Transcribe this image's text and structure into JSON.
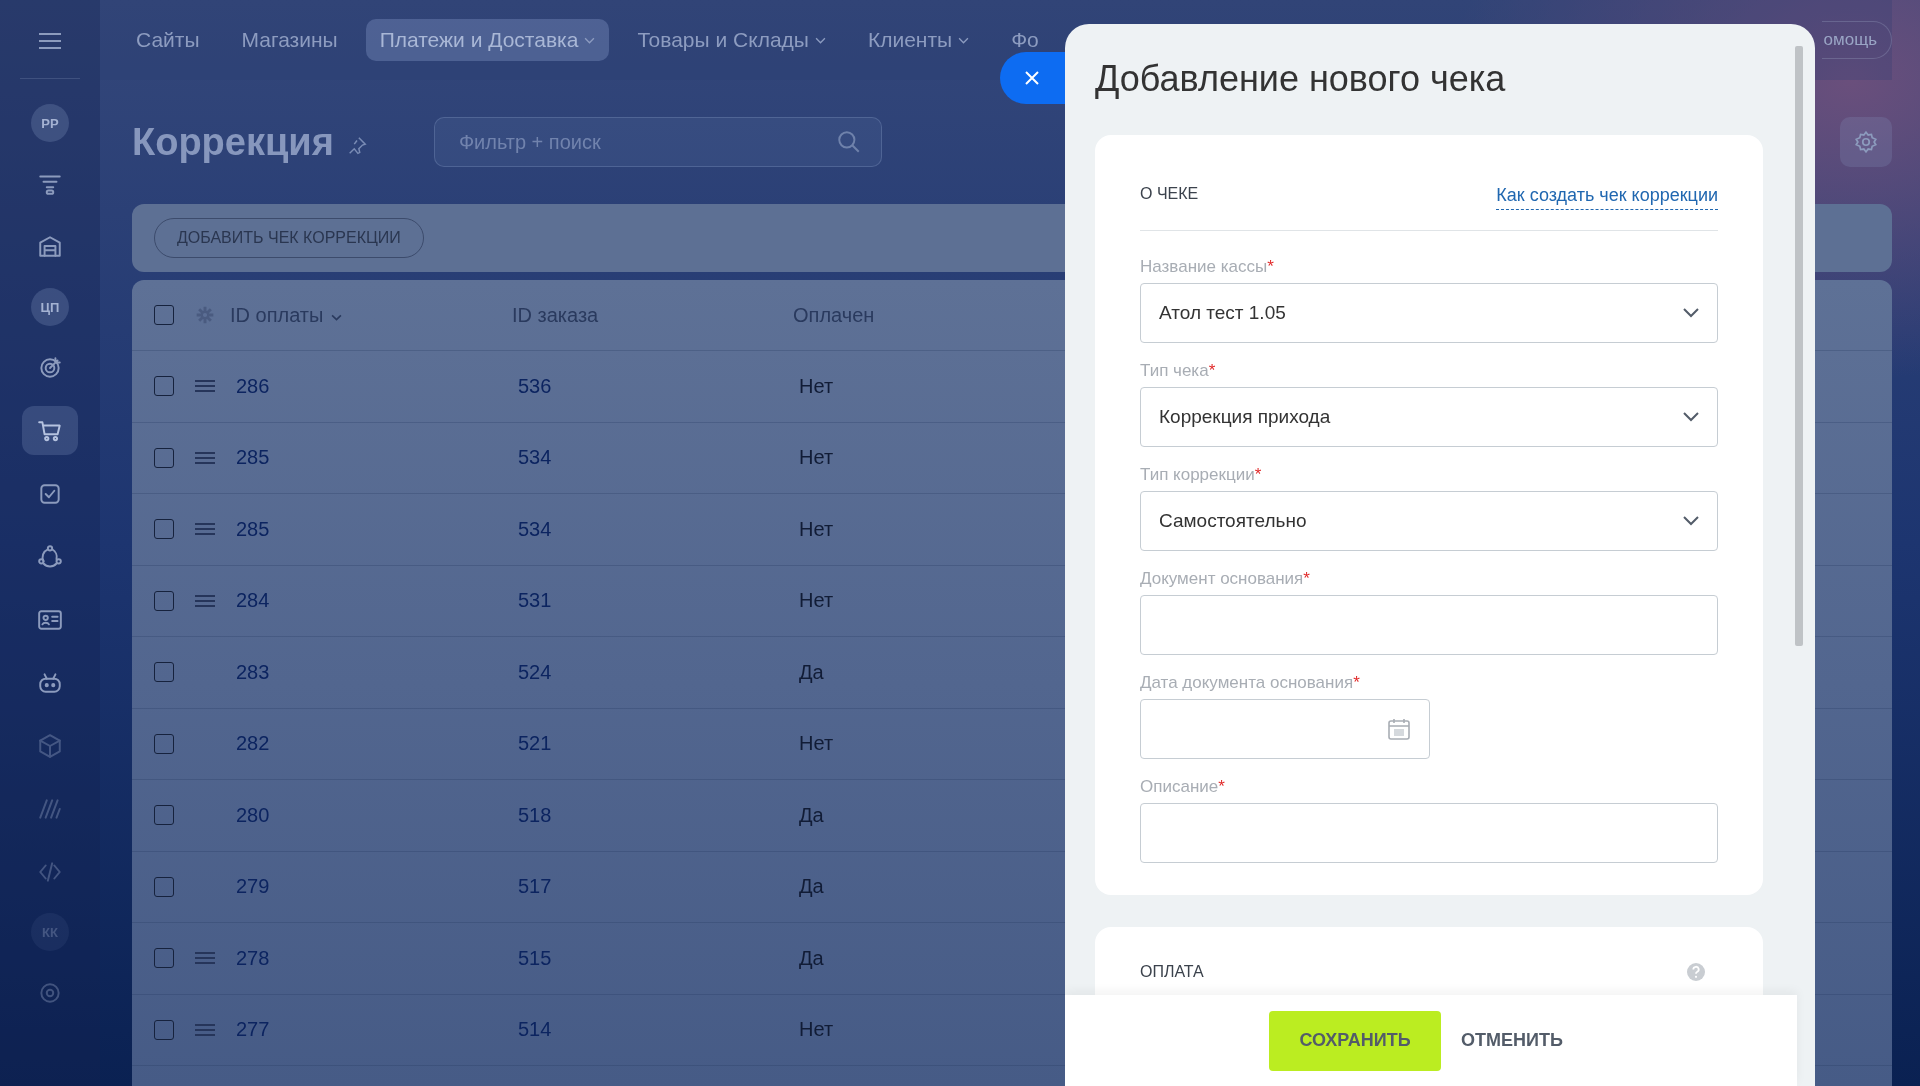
{
  "nav": {
    "items": [
      {
        "label": "Сайты",
        "selected": false,
        "dropdown": false
      },
      {
        "label": "Магазины",
        "selected": false,
        "dropdown": false
      },
      {
        "label": "Платежи и Доставка",
        "selected": true,
        "dropdown": true
      },
      {
        "label": "Товары и Склады",
        "selected": false,
        "dropdown": true
      },
      {
        "label": "Клиенты",
        "selected": false,
        "dropdown": true
      },
      {
        "label": "Фо",
        "selected": false,
        "dropdown": false
      }
    ],
    "help": "омощь"
  },
  "sidebar": {
    "items": [
      {
        "kind": "text",
        "label": "РР",
        "selected": false
      },
      {
        "kind": "icon",
        "selected": false
      },
      {
        "kind": "icon",
        "selected": false
      },
      {
        "kind": "text",
        "label": "ЦП",
        "selected": false
      },
      {
        "kind": "icon",
        "selected": false
      },
      {
        "kind": "icon",
        "selected": true
      },
      {
        "kind": "icon",
        "selected": false
      },
      {
        "kind": "icon",
        "selected": false
      },
      {
        "kind": "icon",
        "selected": false
      },
      {
        "kind": "icon",
        "selected": false
      },
      {
        "kind": "icon",
        "selected": false
      },
      {
        "kind": "icon",
        "selected": false
      },
      {
        "kind": "icon",
        "selected": false
      },
      {
        "kind": "text",
        "label": "КК",
        "selected": false
      },
      {
        "kind": "icon",
        "selected": false
      }
    ]
  },
  "page": {
    "title": "Коррекция",
    "search": {
      "placeholder": "Фильтр + поиск"
    },
    "add_button": "ДОБАВИТЬ ЧЕК КОРРЕКЦИИ"
  },
  "table": {
    "select_all": {
      "checked": false
    },
    "columns": [
      "ID оплаты",
      "ID заказа",
      "Оплачен"
    ],
    "rows": [
      {
        "payment_id": "286",
        "order_id": "536",
        "paid": "Нет",
        "checked": false,
        "handle": true
      },
      {
        "payment_id": "285",
        "order_id": "534",
        "paid": "Нет",
        "checked": false,
        "handle": true
      },
      {
        "payment_id": "285",
        "order_id": "534",
        "paid": "Нет",
        "checked": false,
        "handle": true
      },
      {
        "payment_id": "284",
        "order_id": "531",
        "paid": "Нет",
        "checked": false,
        "handle": true
      },
      {
        "payment_id": "283",
        "order_id": "524",
        "paid": "Да",
        "checked": false,
        "handle": false
      },
      {
        "payment_id": "282",
        "order_id": "521",
        "paid": "Нет",
        "checked": false,
        "handle": false
      },
      {
        "payment_id": "280",
        "order_id": "518",
        "paid": "Да",
        "checked": false,
        "handle": false
      },
      {
        "payment_id": "279",
        "order_id": "517",
        "paid": "Да",
        "checked": false,
        "handle": false
      },
      {
        "payment_id": "278",
        "order_id": "515",
        "paid": "Да",
        "checked": false,
        "handle": true
      },
      {
        "payment_id": "277",
        "order_id": "514",
        "paid": "Нет",
        "checked": false,
        "handle": true
      }
    ]
  },
  "panel": {
    "title": "Добавление нового чека",
    "section": {
      "title": "О ЧЕКЕ",
      "link": "Как создать чек коррекции"
    },
    "fields": [
      {
        "kind": "select",
        "label": "Название кассы",
        "mark": "*",
        "value": "Атол тест 1.05"
      },
      {
        "kind": "select",
        "label": "Тип чека",
        "mark": "*",
        "value": "Коррекция прихода"
      },
      {
        "kind": "select",
        "label": "Тип коррекции",
        "mark": "*",
        "value": "Самостоятельно"
      },
      {
        "kind": "input",
        "label": "Документ основания",
        "mark": "*"
      },
      {
        "kind": "date",
        "label": "Дата документа основания",
        "mark": "*"
      },
      {
        "kind": "input",
        "label": "Описание",
        "mark": "*"
      }
    ],
    "payment_section": "ОПЛАТА",
    "buttons": {
      "save": "СОХРАНИТЬ",
      "cancel": "ОТМЕНИТЬ"
    }
  }
}
